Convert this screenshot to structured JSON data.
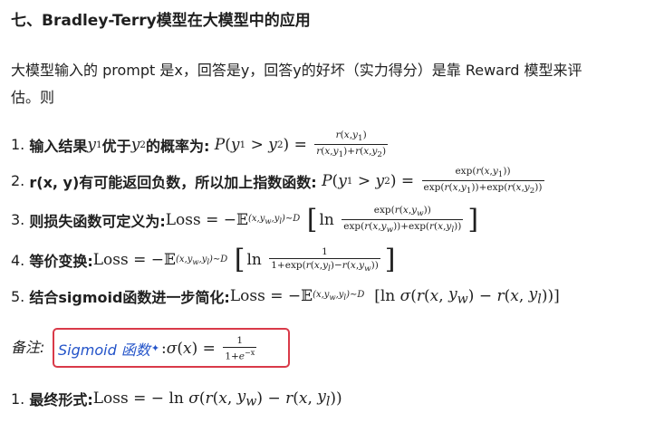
{
  "heading": "七、Bradley-Terry模型在大模型中的应用",
  "intro_line1": "大模型输入的 prompt 是x，回答是y，回答y的好坏（实力得分）是靠 Reward 模型来评",
  "intro_line2": "估。则",
  "items": [
    {
      "num": "1.",
      "label_a": "输入结果",
      "label_b": "优于",
      "label_c": "的概率为:"
    },
    {
      "num": "2.",
      "label": "r(x, y)有可能返回负数，所以加上指数函数:"
    },
    {
      "num": "3.",
      "label": "则损失函数可定义为:"
    },
    {
      "num": "4.",
      "label": "等价变换:"
    },
    {
      "num": "5.",
      "label": "结合sigmoid函数进一步简化:"
    }
  ],
  "note": {
    "label": "备注:",
    "link": "Sigmoid 函数",
    "spark": "✦"
  },
  "final": {
    "num": "1.",
    "label": "最终形式:"
  },
  "colors": {
    "link": "#2454c9",
    "box_border": "#d93a49"
  }
}
